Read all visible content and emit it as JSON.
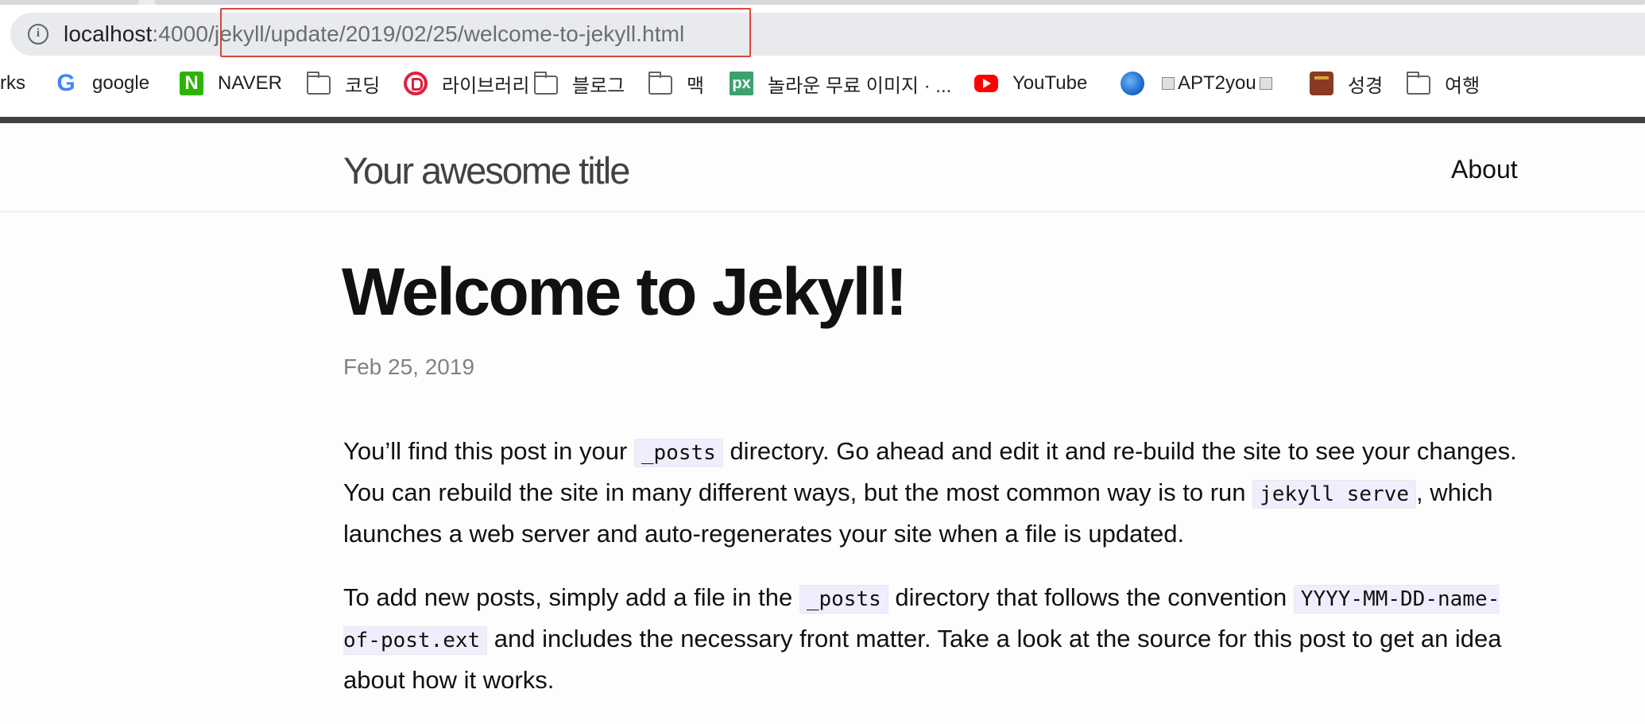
{
  "browser": {
    "url_host": "localhost",
    "url_port": ":4000",
    "url_path": "/jekyll/update/2019/02/25/welcome-to-jekyll.html",
    "bookmarks": [
      {
        "label": "rks",
        "icon": "none"
      },
      {
        "label": "google",
        "icon": "google-icon"
      },
      {
        "label": "NAVER",
        "icon": "naver-icon"
      },
      {
        "label": "코딩",
        "icon": "folder-icon"
      },
      {
        "label": "라이브러리",
        "icon": "library-icon"
      },
      {
        "label": "블로그",
        "icon": "folder-icon"
      },
      {
        "label": "맥",
        "icon": "folder-icon"
      },
      {
        "label": "놀라운 무료 이미지 · ...",
        "icon": "px-icon"
      },
      {
        "label": "YouTube",
        "icon": "youtube-icon"
      },
      {
        "label": "APT2you",
        "icon": "globe-icon"
      },
      {
        "label": "성경",
        "icon": "bible-icon"
      },
      {
        "label": "여행",
        "icon": "folder-icon"
      }
    ],
    "highlight_color": "#d9463a"
  },
  "site": {
    "title": "Your awesome title",
    "nav_about": "About"
  },
  "post": {
    "title": "Welcome to Jekyll!",
    "date": "Feb 25, 2019",
    "p1": {
      "t1": "You’ll find this post in your ",
      "c1": "_posts",
      "t2": " directory. Go ahead and edit it and re-build the site to see your changes. You can rebuild the site in many different ways, but the most common way is to run ",
      "c2": "jekyll serve",
      "t3": ", which launches a web server and auto-regenerates your site when a file is updated."
    },
    "p2": {
      "t1": "To add new posts, simply add a file in the ",
      "c1": "_posts",
      "t2": " directory that follows the convention ",
      "c2": "YYYY-MM-DD-name-of-post.ext",
      "t3": " and includes the necessary front matter. Take a look at the source for this post to get an idea about how it works."
    }
  }
}
